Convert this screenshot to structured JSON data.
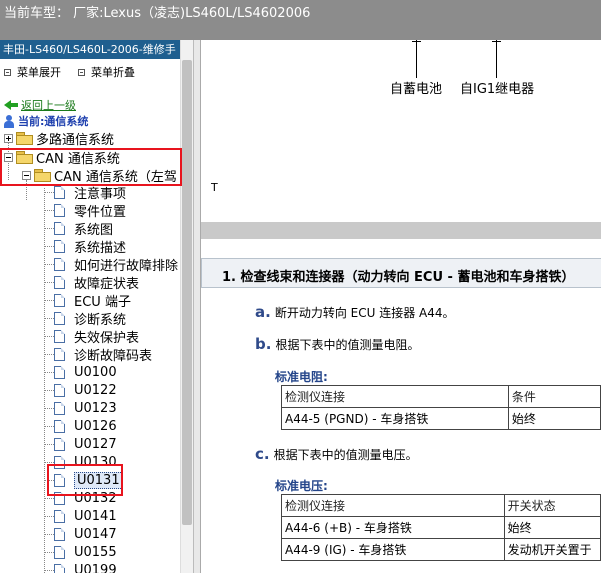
{
  "topbar": {
    "title": "当前车型： 厂家:Lexus（凌志)LS460L/LS4602006"
  },
  "sidebar": {
    "header": "丰田-LS460/LS460L-2006-维修手",
    "expand_label": "菜单展开",
    "collapse_label": "菜单折叠",
    "back_link": "返回上一级",
    "current_label": "当前:通信系统",
    "tree": [
      {
        "label": "多路通信系统",
        "level": 0,
        "type": "folder",
        "toggle": "plus"
      },
      {
        "label": "CAN 通信系统",
        "level": 0,
        "type": "folder",
        "toggle": "minus"
      },
      {
        "label": "CAN 通信系统（左驾",
        "level": 1,
        "type": "folder",
        "toggle": "minus"
      }
    ],
    "pages": [
      "注意事项",
      "零件位置",
      "系统图",
      "系统描述",
      "如何进行故障排除",
      "故障症状表",
      "ECU 端子",
      "诊断系统",
      "失效保护表",
      "诊断故障码表",
      "U0100",
      "U0122",
      "U0123",
      "U0126",
      "U0127",
      "U0130",
      "U0131",
      "U0132",
      "U0141",
      "U0147",
      "U0155",
      "U0199"
    ],
    "selected": "U0131"
  },
  "content": {
    "wiring": {
      "label_left": "自蓄电池",
      "label_right": "自IG1继电器",
      "marker": "T"
    },
    "section_title": "1. 检查线束和连接器（动力转向 ECU - 蓄电池和车身搭铁）",
    "steps": [
      {
        "letter": "a.",
        "text": "断开动力转向 ECU 连接器 A44。"
      },
      {
        "letter": "b.",
        "text": "根据下表中的值测量电阻。"
      },
      {
        "letter": "c.",
        "text": "根据下表中的值测量电压。"
      }
    ],
    "resistance": {
      "title": "标准电阻:",
      "headers": [
        "检测仪连接",
        "条件"
      ],
      "rows": [
        [
          "A44-5 (PGND) - 车身搭铁",
          "始终"
        ]
      ]
    },
    "voltage": {
      "title": "标准电压:",
      "headers": [
        "检测仪连接",
        "开关状态"
      ],
      "rows": [
        [
          "A44-6 (+B) - 车身搭铁",
          "始终"
        ],
        [
          "A44-9 (IG) - 车身搭铁",
          "发动机开关置于"
        ]
      ]
    }
  },
  "colors": {
    "topbar": "#8c8c8c",
    "sidebar_header": "#1f5f8f",
    "highlight_box": "#e8141e",
    "step_letter": "#2f4a8a"
  }
}
